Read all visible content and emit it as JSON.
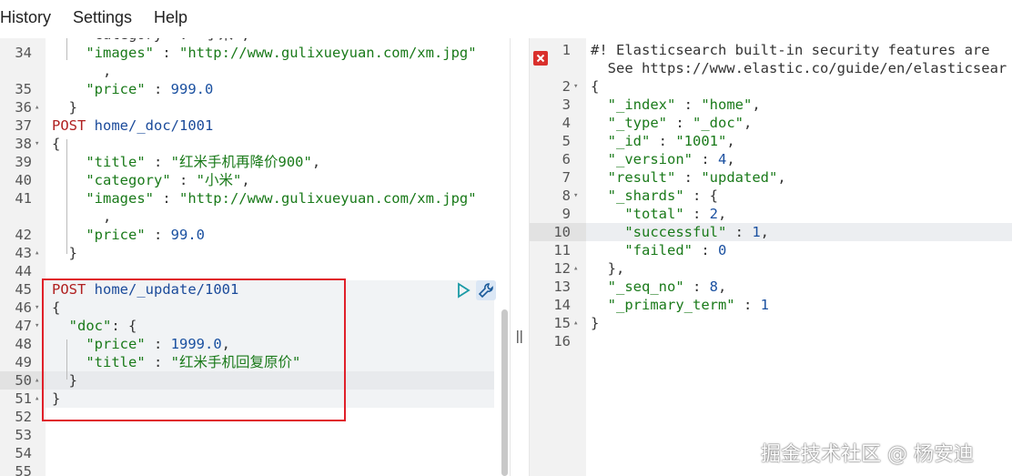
{
  "menu": {
    "items": [
      "History",
      "Settings",
      "Help"
    ]
  },
  "left_editor": {
    "lines": [
      {
        "n": "",
        "fold": "",
        "parts": [
          [
            "p",
            "    \"category\" : \"小米\","
          ]
        ]
      },
      {
        "n": "34",
        "fold": "",
        "parts": [
          [
            "s",
            "    \"images\""
          ],
          [
            "p",
            " : "
          ],
          [
            "s",
            "\"http://www.gulixueyuan.com/xm.jpg\""
          ]
        ]
      },
      {
        "n": "",
        "fold": "",
        "parts": [
          [
            "p",
            "      ,"
          ]
        ]
      },
      {
        "n": "35",
        "fold": "",
        "parts": [
          [
            "s",
            "    \"price\""
          ],
          [
            "p",
            " : "
          ],
          [
            "n",
            "999.0"
          ]
        ]
      },
      {
        "n": "36",
        "fold": "▴",
        "parts": [
          [
            "p",
            "  }"
          ]
        ]
      },
      {
        "n": "37",
        "fold": "",
        "parts": [
          [
            "k",
            "POST"
          ],
          [
            "p",
            " "
          ],
          [
            "u",
            "home/_doc/1001"
          ]
        ]
      },
      {
        "n": "38",
        "fold": "▾",
        "parts": [
          [
            "p",
            "{"
          ]
        ]
      },
      {
        "n": "39",
        "fold": "",
        "parts": [
          [
            "s",
            "    \"title\""
          ],
          [
            "p",
            " : "
          ],
          [
            "s",
            "\"红米手机再降价900\""
          ],
          [
            "p",
            ","
          ]
        ]
      },
      {
        "n": "40",
        "fold": "",
        "parts": [
          [
            "s",
            "    \"category\""
          ],
          [
            "p",
            " : "
          ],
          [
            "s",
            "\"小米\""
          ],
          [
            "p",
            ","
          ]
        ]
      },
      {
        "n": "41",
        "fold": "",
        "parts": [
          [
            "s",
            "    \"images\""
          ],
          [
            "p",
            " : "
          ],
          [
            "s",
            "\"http://www.gulixueyuan.com/xm.jpg\""
          ]
        ]
      },
      {
        "n": "",
        "fold": "",
        "parts": [
          [
            "p",
            "      ,"
          ]
        ]
      },
      {
        "n": "42",
        "fold": "",
        "parts": [
          [
            "s",
            "    \"price\""
          ],
          [
            "p",
            " : "
          ],
          [
            "n",
            "99.0"
          ]
        ]
      },
      {
        "n": "43",
        "fold": "▴",
        "parts": [
          [
            "p",
            "  }"
          ]
        ]
      },
      {
        "n": "44",
        "fold": "",
        "parts": []
      },
      {
        "n": "45",
        "fold": "",
        "parts": [
          [
            "k",
            "POST"
          ],
          [
            "p",
            " "
          ],
          [
            "u",
            "home/_update/1001"
          ]
        ]
      },
      {
        "n": "46",
        "fold": "▾",
        "parts": [
          [
            "p",
            "{"
          ]
        ]
      },
      {
        "n": "47",
        "fold": "▾",
        "parts": [
          [
            "s",
            "  \"doc\""
          ],
          [
            "p",
            ": {"
          ]
        ]
      },
      {
        "n": "48",
        "fold": "",
        "parts": [
          [
            "s",
            "    \"price\""
          ],
          [
            "p",
            " : "
          ],
          [
            "n",
            "1999.0"
          ],
          [
            "p",
            ","
          ]
        ]
      },
      {
        "n": "49",
        "fold": "",
        "parts": [
          [
            "s",
            "    \"title\""
          ],
          [
            "p",
            " : "
          ],
          [
            "s",
            "\"红米手机回复原价\""
          ]
        ]
      },
      {
        "n": "50",
        "fold": "▴",
        "parts": [
          [
            "p",
            "  }"
          ]
        ]
      },
      {
        "n": "51",
        "fold": "▴",
        "parts": [
          [
            "p",
            "}"
          ]
        ]
      },
      {
        "n": "52",
        "fold": "",
        "parts": []
      },
      {
        "n": "53",
        "fold": "",
        "parts": []
      },
      {
        "n": "54",
        "fold": "",
        "parts": []
      },
      {
        "n": "55",
        "fold": "",
        "parts": []
      }
    ]
  },
  "right_editor": {
    "lines": [
      {
        "n": "1",
        "fold": "",
        "parts": [
          [
            "p",
            "#! Elasticsearch built-in security features are"
          ]
        ]
      },
      {
        "n": "",
        "fold": "",
        "parts": [
          [
            "p",
            "  See https://www.elastic.co/guide/en/elasticsear"
          ]
        ]
      },
      {
        "n": "2",
        "fold": "▾",
        "parts": [
          [
            "p",
            "{"
          ]
        ]
      },
      {
        "n": "3",
        "fold": "",
        "parts": [
          [
            "s",
            "  \"_index\""
          ],
          [
            "p",
            " : "
          ],
          [
            "s",
            "\"home\""
          ],
          [
            "p",
            ","
          ]
        ]
      },
      {
        "n": "4",
        "fold": "",
        "parts": [
          [
            "s",
            "  \"_type\""
          ],
          [
            "p",
            " : "
          ],
          [
            "s",
            "\"_doc\""
          ],
          [
            "p",
            ","
          ]
        ]
      },
      {
        "n": "5",
        "fold": "",
        "parts": [
          [
            "s",
            "  \"_id\""
          ],
          [
            "p",
            " : "
          ],
          [
            "s",
            "\"1001\""
          ],
          [
            "p",
            ","
          ]
        ]
      },
      {
        "n": "6",
        "fold": "",
        "parts": [
          [
            "s",
            "  \"_version\""
          ],
          [
            "p",
            " : "
          ],
          [
            "n",
            "4"
          ],
          [
            "p",
            ","
          ]
        ]
      },
      {
        "n": "7",
        "fold": "",
        "parts": [
          [
            "s",
            "  \"result\""
          ],
          [
            "p",
            " : "
          ],
          [
            "s",
            "\"updated\""
          ],
          [
            "p",
            ","
          ]
        ]
      },
      {
        "n": "8",
        "fold": "▾",
        "parts": [
          [
            "s",
            "  \"_shards\""
          ],
          [
            "p",
            " : {"
          ]
        ]
      },
      {
        "n": "9",
        "fold": "",
        "parts": [
          [
            "s",
            "    \"total\""
          ],
          [
            "p",
            " : "
          ],
          [
            "n",
            "2"
          ],
          [
            "p",
            ","
          ]
        ]
      },
      {
        "n": "10",
        "fold": "",
        "parts": [
          [
            "s",
            "    \"successful\""
          ],
          [
            "p",
            " : "
          ],
          [
            "n",
            "1"
          ],
          [
            "p",
            ","
          ]
        ]
      },
      {
        "n": "11",
        "fold": "",
        "parts": [
          [
            "s",
            "    \"failed\""
          ],
          [
            "p",
            " : "
          ],
          [
            "n",
            "0"
          ]
        ]
      },
      {
        "n": "12",
        "fold": "▴",
        "parts": [
          [
            "p",
            "  },"
          ]
        ]
      },
      {
        "n": "13",
        "fold": "",
        "parts": [
          [
            "s",
            "  \"_seq_no\""
          ],
          [
            "p",
            " : "
          ],
          [
            "n",
            "8"
          ],
          [
            "p",
            ","
          ]
        ]
      },
      {
        "n": "14",
        "fold": "",
        "parts": [
          [
            "s",
            "  \"_primary_term\""
          ],
          [
            "p",
            " : "
          ],
          [
            "n",
            "1"
          ]
        ]
      },
      {
        "n": "15",
        "fold": "▴",
        "parts": [
          [
            "p",
            "}"
          ]
        ]
      },
      {
        "n": "16",
        "fold": "",
        "parts": []
      }
    ]
  },
  "watermark": "掘金技术社区 @ 杨安迪",
  "colors": {
    "highlight_box": "#e0202a",
    "error_icon": "#d9302c",
    "keyword": "#b02020"
  }
}
